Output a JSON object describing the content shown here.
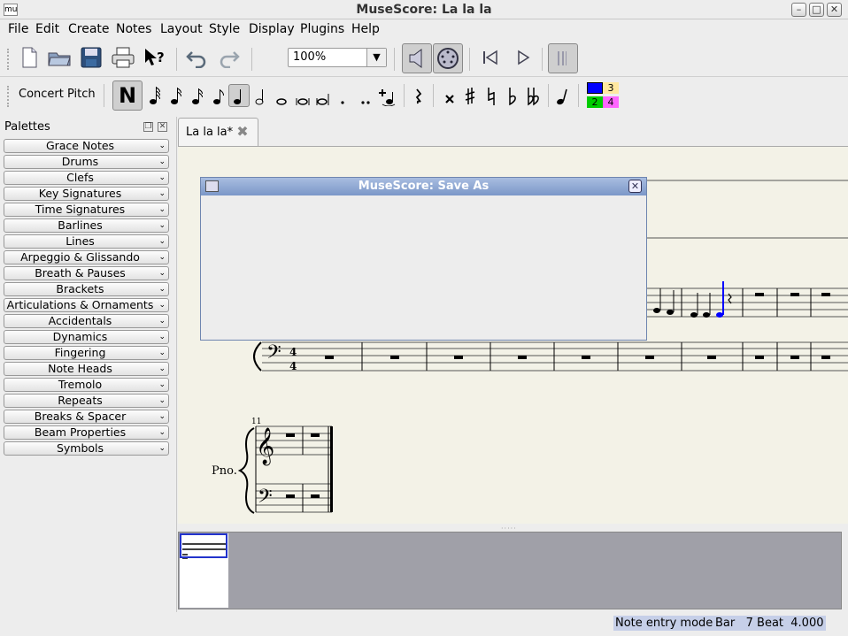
{
  "window": {
    "title": "MuseScore: La la la",
    "app_icon": "mu"
  },
  "menu": [
    "File",
    "Edit",
    "Create",
    "Notes",
    "Layout",
    "Style",
    "Display",
    "Plugins",
    "Help"
  ],
  "toolbar": {
    "zoom": "100%"
  },
  "note_input": {
    "concert_pitch": "Concert Pitch",
    "note_entry_symbol": "N",
    "voices": [
      "3",
      "2",
      "4"
    ],
    "voice_colors": {
      "v1": "#0000ff",
      "v2": "#00cc00",
      "v3": "#ffe8a0",
      "v4": "#ff66ff"
    }
  },
  "palettes": {
    "title": "Palettes",
    "items": [
      "Grace Notes",
      "Drums",
      "Clefs",
      "Key Signatures",
      "Time Signatures",
      "Barlines",
      "Lines",
      "Arpeggio & Glissando",
      "Breath & Pauses",
      "Brackets",
      "Articulations & Ornaments",
      "Accidentals",
      "Dynamics",
      "Fingering",
      "Note Heads",
      "Tremolo",
      "Repeats",
      "Breaks & Spacer",
      "Beam Properties",
      "Symbols"
    ]
  },
  "score": {
    "tab": "La la la*",
    "time_signature": [
      "4",
      "4"
    ],
    "measure_number": "11",
    "instrument": "Pno.",
    "selected_note_color": "#0000ff"
  },
  "dialog": {
    "title": "MuseScore: Save As"
  },
  "status": {
    "mode": "Note entry mode",
    "position": "Bar   7 Beat  4.000"
  }
}
